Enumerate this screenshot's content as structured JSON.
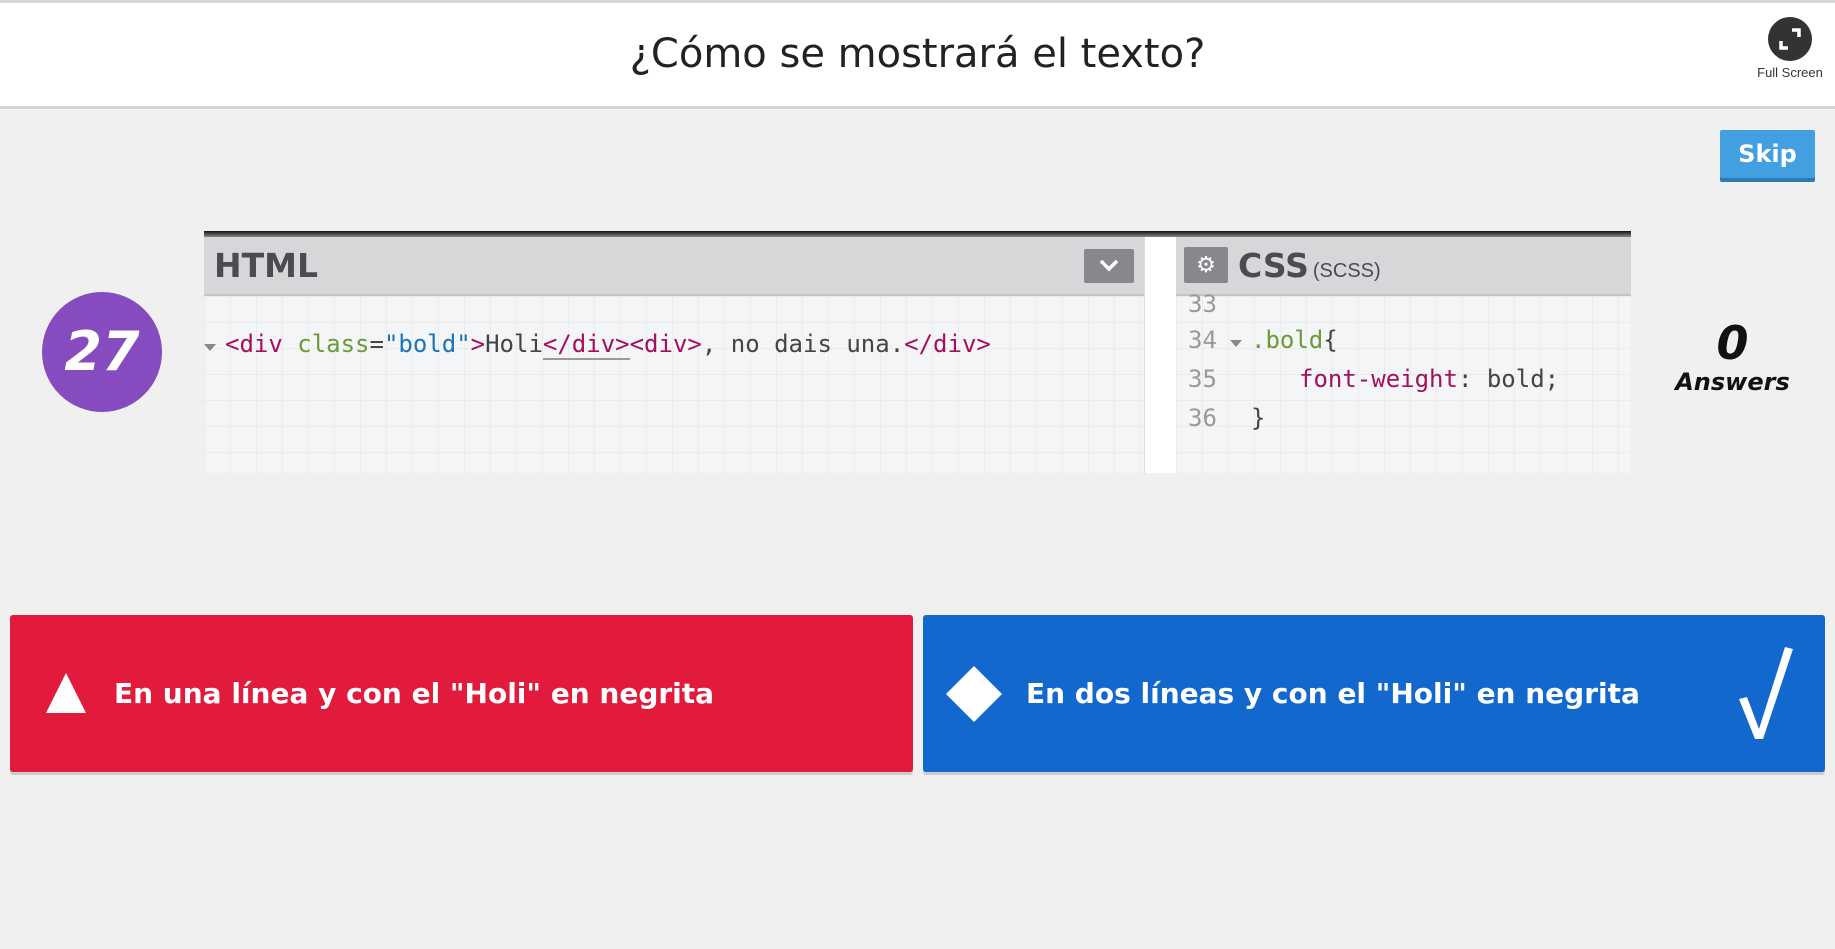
{
  "header": {
    "question": "¿Cómo se mostrará el texto?",
    "fullscreen_label": "Full Screen"
  },
  "controls": {
    "skip_label": "Skip"
  },
  "question_number": "27",
  "answers_count": {
    "value": "0",
    "label": "Answers"
  },
  "code_image": {
    "html_panel": {
      "title": "HTML",
      "code": {
        "open1": "<div ",
        "attr": "class",
        "eq": "=",
        "value": "\"bold\"",
        "close_bracket": ">",
        "text1": "Holi",
        "close_tag1": "</div>",
        "open2": "<div>",
        "text2": ", no dais una.",
        "close_tag2": "</div>"
      }
    },
    "css_panel": {
      "title": "CSS",
      "subtitle": "(SCSS)",
      "lines": [
        {
          "num": "33",
          "selector": "",
          "property": "",
          "value": "",
          "brace": ""
        },
        {
          "num": "34",
          "selector": ".bold",
          "property": "",
          "value": "",
          "brace": "{"
        },
        {
          "num": "35",
          "selector": "",
          "property": "font-weight",
          "value": ": bold;",
          "brace": ""
        },
        {
          "num": "36",
          "selector": "",
          "property": "",
          "value": "",
          "brace": "}"
        }
      ]
    }
  },
  "options": [
    {
      "shape": "triangle",
      "text": "En una línea y con el \"Holi\" en negrita",
      "color": "#e21b3c",
      "correct": false
    },
    {
      "shape": "diamond",
      "text": "En dos líneas y con el \"Holi\" en negrita",
      "color": "#1368ce",
      "correct": true,
      "mark": "√"
    }
  ],
  "colors": {
    "question_number_bg": "#864cbf",
    "skip_bg": "#43a0e0",
    "page_bg": "#f0f0f0"
  },
  "icons": [
    "expand-icon",
    "chevron-down-icon",
    "gear-icon",
    "triangle-icon",
    "diamond-icon",
    "checkmark-icon"
  ]
}
